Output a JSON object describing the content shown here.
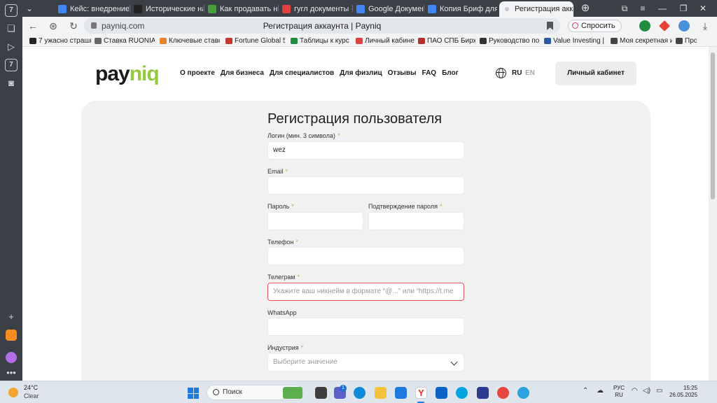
{
  "browser": {
    "tabs": [
      {
        "label": "Кейс: внедрение о",
        "fav_color": "#4285f4"
      },
      {
        "label": "Исторические нап",
        "fav_color": "#222222"
      },
      {
        "label": "Как продавать нар",
        "fav_color": "#4a9d3a"
      },
      {
        "label": "гугл документы —",
        "fav_color": "#e04040"
      },
      {
        "label": "Google Документы",
        "fav_color": "#4285f4"
      },
      {
        "label": "Копия Бриф для с",
        "fav_color": "#4285f4"
      },
      {
        "label": "Регистрация акка",
        "fav_color": "#9aa0a6"
      }
    ],
    "url_domain": "payniq.com",
    "page_title": "Регистрация аккаунта | Payniq",
    "ask_label": "Спросить",
    "bookmarks": [
      {
        "label": "7 ужасно страшн",
        "fav_color": "#222222"
      },
      {
        "label": "Ставка RUONIA (I",
        "fav_color": "#666666"
      },
      {
        "label": "Ключевые ставки",
        "fav_color": "#e6842a"
      },
      {
        "label": "Fortune Global 50(",
        "fav_color": "#c0392b"
      },
      {
        "label": "Таблицы к курсу",
        "fav_color": "#1e8e3e"
      },
      {
        "label": "Личный кабинет",
        "fav_color": "#e04040"
      },
      {
        "label": "ПАО СПБ Биржа",
        "fav_color": "#b0302a"
      },
      {
        "label": "Руководство по р",
        "fav_color": "#333333"
      },
      {
        "label": "Value Investing | M",
        "fav_color": "#2d5aa0"
      },
      {
        "label": "Моя секретная и",
        "fav_color": "#444444"
      },
      {
        "label": "Про",
        "fav_color": "#444444"
      }
    ]
  },
  "site": {
    "logo_pay": "pay",
    "logo_niq": "niq",
    "nav": [
      "О проекте",
      "Для бизнеса",
      "Для специалистов",
      "Для физлиц",
      "Отзывы",
      "FAQ",
      "Блог"
    ],
    "lang_ru": "RU",
    "lang_en": "EN",
    "cabinet_label": "Личный кабинет"
  },
  "form": {
    "title": "Регистрация пользователя",
    "required_mark": "*",
    "login_label": "Логин (мин. 3 символа)",
    "login_value": "wez",
    "email_label": "Email",
    "password_label": "Пароль",
    "password_confirm_label": "Подтверждение пароля",
    "phone_label": "Телефон",
    "telegram_label": "Телеграм",
    "telegram_placeholder": "Укажите ваш никнейм в формате “@...” или “https://t.me",
    "whatsapp_label": "WhatsApp",
    "industry_label": "Индустрия",
    "industry_placeholder": "Выберите значение"
  },
  "taskbar": {
    "temp": "24°C",
    "condition": "Clear",
    "search_label": "Поиск",
    "badge_count": "1",
    "lang_line1": "РУС",
    "lang_line2": "RU",
    "time": "15:25",
    "date": "26.05.2025"
  },
  "colors": {
    "brand_green": "#95c93d",
    "error_red": "#e0555a",
    "chrome_dark": "#3b3f46"
  }
}
